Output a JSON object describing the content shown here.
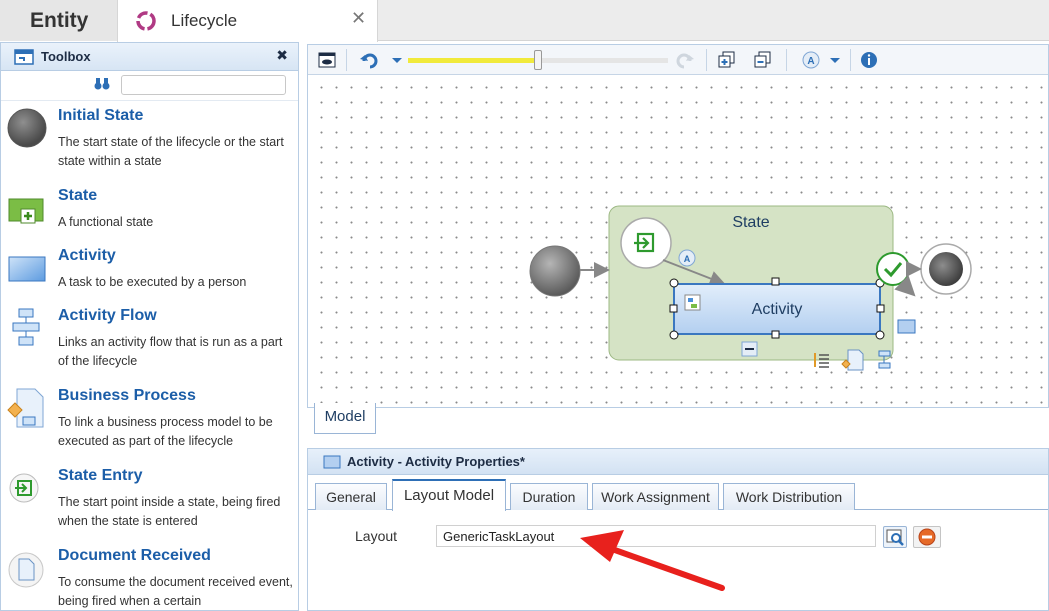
{
  "tabs": {
    "entity": "Entity",
    "lifecycle": "Lifecycle",
    "close": "✕"
  },
  "toolbox": {
    "title": "Toolbox",
    "close": "✖",
    "search_placeholder": "",
    "items": [
      {
        "title": "Initial State",
        "desc": "The start state of the lifecycle or the start state within a state",
        "icon": "initial-state-icon"
      },
      {
        "title": "State",
        "desc": "A functional state",
        "icon": "state-icon"
      },
      {
        "title": "Activity",
        "desc": "A task to be executed by a person",
        "icon": "activity-icon"
      },
      {
        "title": "Activity Flow",
        "desc": "Links an activity flow that is run as a part of the lifecycle",
        "icon": "activity-flow-icon"
      },
      {
        "title": "Business Process",
        "desc": "To link a business process model to be executed as part of the lifecycle",
        "icon": "business-process-icon"
      },
      {
        "title": "State Entry",
        "desc": "The start point inside a state, being fired when the state is entered",
        "icon": "state-entry-icon"
      },
      {
        "title": "Document Received",
        "desc": "To consume the document received event, being fired when a certain",
        "icon": "document-received-icon"
      }
    ]
  },
  "editor": {
    "zoom_fraction": 0.5,
    "state_label": "State",
    "activity_label": "Activity",
    "annotation_glyph": "A"
  },
  "model_tab": "Model",
  "properties": {
    "title": "Activity - Activity Properties*",
    "tabs": [
      "General",
      "Layout Model",
      "Duration",
      "Work Assignment",
      "Work Distribution"
    ],
    "active_tab": "Layout Model",
    "layout_label": "Layout",
    "layout_value": "GenericTaskLayout"
  },
  "colors": {
    "accent": "#1c5ea8",
    "state_fill": "#d5e3c5",
    "activity_fill": "#c6dbf3",
    "arrow": "#e8211d",
    "zoom_slider": "#f1ea3c"
  }
}
